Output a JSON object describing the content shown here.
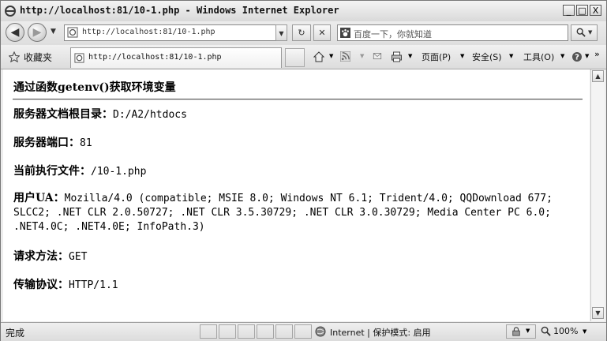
{
  "window": {
    "title": "http://localhost:81/10-1.php - Windows Internet Explorer",
    "min_glyph": "_",
    "max_glyph": "□",
    "close_glyph": "X"
  },
  "nav": {
    "back_glyph": "◀",
    "forward_glyph": "▶",
    "address": "http://localhost:81/10-1.php",
    "search_placeholder": "百度一下，你就知道",
    "refresh_glyph": "↻",
    "stop_glyph": "✕"
  },
  "favorites_bar": {
    "favorites_label": "收藏夹",
    "tab_title": "http://localhost:81/10-1.php"
  },
  "command_bar": {
    "page_menu": "页面(P)",
    "safety_menu": "安全(S)",
    "tools_menu": "工具(O)"
  },
  "page": {
    "title": "通过函数getenv()获取环境变量",
    "docroot_label": "服务器文档根目录：",
    "docroot_value": "D:/A2/htdocs",
    "port_label": "服务器端口：",
    "port_value": "81",
    "script_label": "当前执行文件：",
    "script_value": "/10-1.php",
    "ua_label": "用户UA：",
    "ua_value": "Mozilla/4.0 (compatible; MSIE 8.0; Windows NT 6.1; Trident/4.0; QQDownload 677; SLCC2; .NET CLR 2.0.50727; .NET CLR 3.5.30729; .NET CLR 3.0.30729; Media Center PC 6.0; .NET4.0C; .NET4.0E; InfoPath.3)",
    "method_label": "请求方法：",
    "method_value": "GET",
    "protocol_label": "传输协议：",
    "protocol_value": "HTTP/1.1"
  },
  "status": {
    "text": "完成",
    "zone": "Internet | 保护模式: 启用",
    "zoom": "100%"
  }
}
